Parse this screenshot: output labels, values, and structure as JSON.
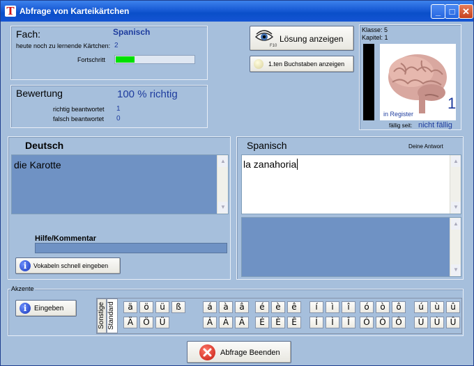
{
  "window": {
    "title": "Abfrage von Karteikärtchen",
    "icon": "app-icon",
    "controls": {
      "minimize": "_",
      "maximize": "□",
      "close": "✕"
    }
  },
  "info": {
    "fach_label": "Fach:",
    "fach_value": "Spanisch",
    "remaining_label": "heute noch zu lernende Kärtchen:",
    "remaining_value": "2",
    "progress_label": "Fortschritt",
    "progress_fraction": 0.24
  },
  "rating": {
    "label": "Bewertung",
    "percent_text": "100 % richtig",
    "correct_label": "richtig beantwortet",
    "correct_value": "1",
    "wrong_label": "falsch beantwortet",
    "wrong_value": "0"
  },
  "actions": {
    "show_solution": "Lösung anzeigen",
    "show_solution_shortcut": "F10",
    "first_letter": "1.ten Buchstaben anzeigen"
  },
  "register": {
    "klasse": "Klasse: 5",
    "kapitel": "Kapitel: 1",
    "in_register": "in Register",
    "register_number": "1",
    "due_label": "fällig seit:",
    "due_value": "nicht fällig"
  },
  "german": {
    "heading": "Deutsch",
    "word": "die Karotte",
    "help_label": "Hilfe/Kommentar",
    "quick_entry_button": "Vokabeln schnell eingeben"
  },
  "spanish": {
    "heading": "Spanisch",
    "answer_label": "Deine Antwort",
    "answer_text": "la zanahoria"
  },
  "accents": {
    "label": "Akzente",
    "input_button": "Eingeben",
    "tab_sonstige": "Sonstige",
    "tab_standard": "Standard",
    "groups": [
      {
        "lower": [
          "ä",
          "ö",
          "ü",
          "ß"
        ],
        "upper": [
          "Ä",
          "Ö",
          "Ü"
        ]
      },
      {
        "lower": [
          "á",
          "à",
          "â"
        ],
        "upper": [
          "Á",
          "À",
          "Â"
        ]
      },
      {
        "lower": [
          "é",
          "è",
          "ê"
        ],
        "upper": [
          "É",
          "È",
          "Ê"
        ]
      },
      {
        "lower": [
          "í",
          "ì",
          "î"
        ],
        "upper": [
          "Í",
          "Ì",
          "Î"
        ]
      },
      {
        "lower": [
          "ó",
          "ò",
          "ô"
        ],
        "upper": [
          "Ó",
          "Ò",
          "Ô"
        ]
      },
      {
        "lower": [
          "ú",
          "ù",
          "û"
        ],
        "upper": [
          "Ú",
          "Ù",
          "Û"
        ]
      }
    ]
  },
  "footer": {
    "end_button": "Abfrage Beenden"
  },
  "colors": {
    "window_bg": "#a6bfdc",
    "accent_blue": "#1e3c9e",
    "progress_green": "#00e000",
    "textarea_dark": "#6f92c4"
  }
}
